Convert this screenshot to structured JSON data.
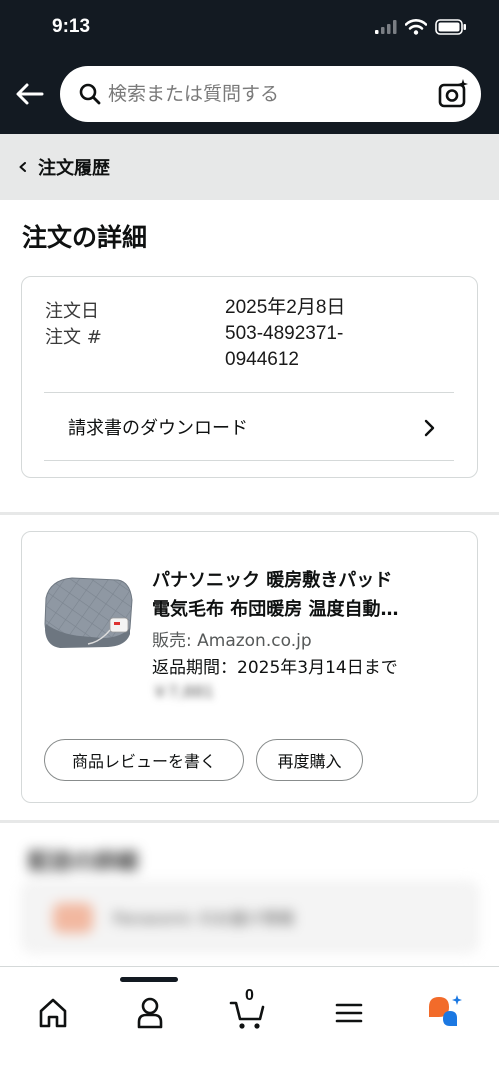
{
  "status_bar": {
    "time": "9:13"
  },
  "search": {
    "placeholder": "検索または質問する"
  },
  "breadcrumb": {
    "label": "注文履歴"
  },
  "page": {
    "title": "注文の詳細"
  },
  "order": {
    "date_label": "注文日",
    "date_value": "2025年2月8日",
    "number_label": "注文 #",
    "number_line1": "503-4892371-",
    "number_line2": "0944612",
    "invoice_label": "請求書のダウンロード"
  },
  "product": {
    "title_line1": "パナソニック 暖房敷きパッド",
    "title_line2": "電気毛布 布団暖房 温度自動…",
    "seller": "販売: Amazon.co.jp",
    "return_period": "返品期間：2025年3月14日まで",
    "price_blurred": "￥7,881",
    "review_button": "商品レビューを書く",
    "rebuy_button": "再度購入"
  },
  "blurred_section": {
    "title": "配送の詳細",
    "item_text": "Panasonic のお届け情報"
  },
  "bottom_nav": {
    "items": [
      "home-icon",
      "account-icon",
      "cart-icon",
      "menu-icon",
      "rufus-icon"
    ],
    "cart_count": "0",
    "active_index": 1
  },
  "colors": {
    "header_bg": "#131a22",
    "breadcrumb_bg": "#e7e8e8",
    "border": "#d5d9d9",
    "rufus_orange": "#f26b2a",
    "rufus_blue": "#1b78e2"
  }
}
